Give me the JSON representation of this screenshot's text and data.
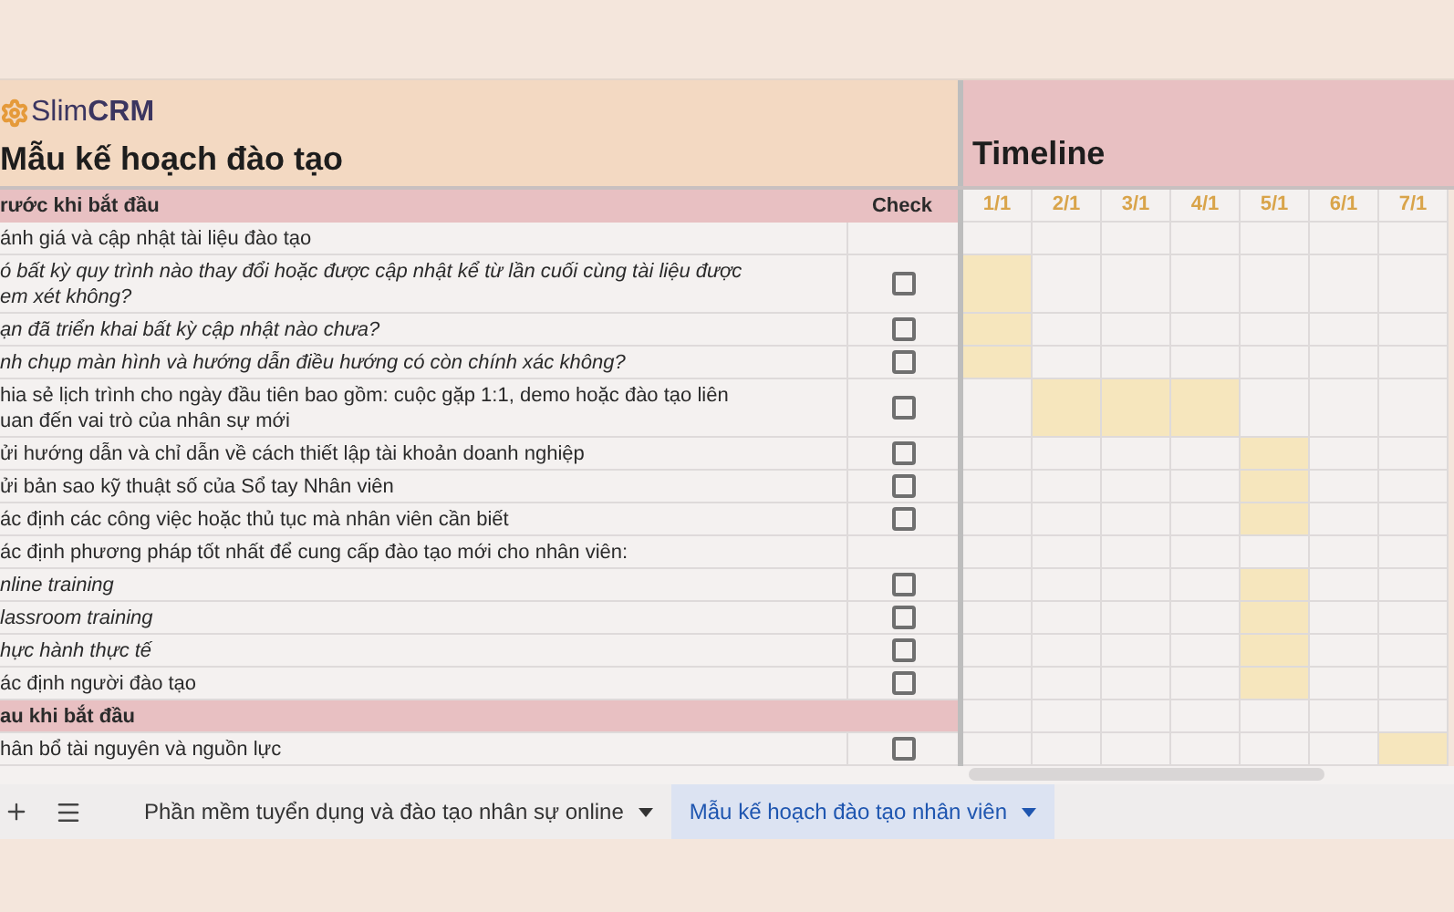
{
  "logo": "Slim**CRM**",
  "title": "Mẫu kế hoạch đào tạo",
  "timeline_title": "Timeline",
  "columns": {
    "task": "rước khi bắt đầu",
    "check": "Check"
  },
  "dates": [
    "1/1",
    "2/1",
    "3/1",
    "4/1",
    "5/1",
    "6/1",
    "7/1"
  ],
  "rows": [
    {
      "kind": "note",
      "italic": false,
      "lines": [
        "ánh giá và cập nhật tài liệu đào tạo"
      ],
      "timeline": [
        false,
        false,
        false,
        false,
        false,
        false,
        false
      ]
    },
    {
      "kind": "task",
      "italic": true,
      "checked": false,
      "lines": [
        "ó bất kỳ quy trình nào thay đổi hoặc được cập nhật kể từ lần cuối cùng tài liệu được",
        "em xét không?"
      ],
      "timeline": [
        true,
        false,
        false,
        false,
        false,
        false,
        false
      ]
    },
    {
      "kind": "task",
      "italic": true,
      "checked": false,
      "lines": [
        "ạn đã triển khai bất kỳ cập nhật nào chưa?"
      ],
      "timeline": [
        true,
        false,
        false,
        false,
        false,
        false,
        false
      ]
    },
    {
      "kind": "task",
      "italic": true,
      "checked": false,
      "lines": [
        "nh chụp màn hình và hướng dẫn điều hướng có còn chính xác không?"
      ],
      "timeline": [
        true,
        false,
        false,
        false,
        false,
        false,
        false
      ]
    },
    {
      "kind": "task",
      "italic": false,
      "checked": false,
      "lines": [
        "hia sẻ lịch trình cho ngày đầu tiên bao gồm: cuộc gặp 1:1, demo hoặc đào tạo liên",
        "uan đến vai trò của nhân sự mới"
      ],
      "timeline": [
        false,
        true,
        true,
        true,
        false,
        false,
        false
      ]
    },
    {
      "kind": "task",
      "italic": false,
      "checked": false,
      "lines": [
        "ửi hướng dẫn và chỉ dẫn về cách thiết lập tài khoản doanh nghiệp"
      ],
      "timeline": [
        false,
        false,
        false,
        false,
        true,
        false,
        false
      ]
    },
    {
      "kind": "task",
      "italic": false,
      "checked": false,
      "lines": [
        "ửi bản sao kỹ thuật số của Sổ tay Nhân viên"
      ],
      "timeline": [
        false,
        false,
        false,
        false,
        true,
        false,
        false
      ]
    },
    {
      "kind": "task",
      "italic": false,
      "checked": false,
      "lines": [
        "ác định các công việc hoặc thủ tục mà nhân viên cần biết"
      ],
      "timeline": [
        false,
        false,
        false,
        false,
        true,
        false,
        false
      ]
    },
    {
      "kind": "note",
      "italic": false,
      "lines": [
        "ác định phương pháp tốt nhất để cung cấp đào tạo mới cho nhân viên:"
      ],
      "timeline": [
        false,
        false,
        false,
        false,
        false,
        false,
        false
      ]
    },
    {
      "kind": "task",
      "italic": true,
      "checked": false,
      "lines": [
        "nline training"
      ],
      "timeline": [
        false,
        false,
        false,
        false,
        true,
        false,
        false
      ]
    },
    {
      "kind": "task",
      "italic": true,
      "checked": false,
      "lines": [
        "lassroom training"
      ],
      "timeline": [
        false,
        false,
        false,
        false,
        true,
        false,
        false
      ]
    },
    {
      "kind": "task",
      "italic": true,
      "checked": false,
      "lines": [
        "hực hành thực tế"
      ],
      "timeline": [
        false,
        false,
        false,
        false,
        true,
        false,
        false
      ]
    },
    {
      "kind": "task",
      "italic": false,
      "checked": false,
      "lines": [
        "ác định người đào tạo"
      ],
      "timeline": [
        false,
        false,
        false,
        false,
        true,
        false,
        false
      ]
    },
    {
      "kind": "section",
      "italic": false,
      "lines": [
        "au khi bắt đầu"
      ],
      "timeline": [
        false,
        false,
        false,
        false,
        false,
        false,
        false
      ]
    },
    {
      "kind": "task",
      "italic": false,
      "checked": false,
      "lines": [
        "hân bổ tài nguyên và nguồn lực"
      ],
      "timeline": [
        false,
        false,
        false,
        false,
        false,
        false,
        true
      ]
    }
  ],
  "sheet_tabs": [
    {
      "label": "Phần mềm tuyển dụng và đào tạo nhân sự online",
      "selected": false
    },
    {
      "label": "Mẫu kế hoạch đào tạo nhân viên",
      "selected": true
    }
  ]
}
